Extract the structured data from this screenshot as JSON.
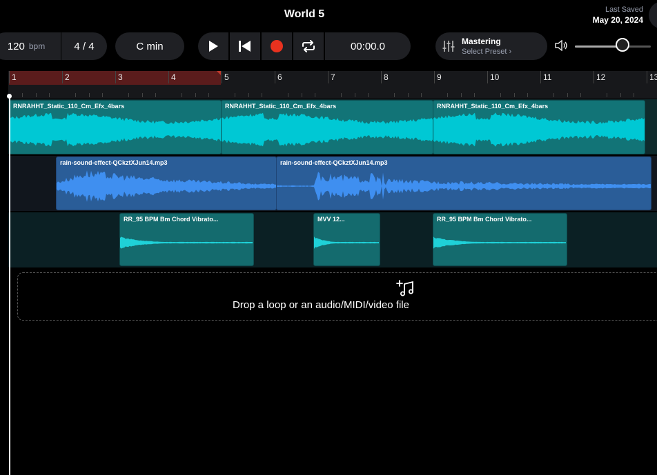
{
  "header": {
    "project_title": "World 5",
    "last_saved_label": "Last Saved",
    "last_saved_date": "May 20, 2024"
  },
  "toolbar": {
    "tempo_value": "120",
    "tempo_unit": "bpm",
    "time_signature": "4 / 4",
    "key": "C min",
    "timecode": "00:00.0",
    "mastering_title": "Mastering",
    "mastering_subtitle": "Select Preset",
    "volume_level": 0.63,
    "icons": [
      "play-icon",
      "skip-to-start-icon",
      "record-icon",
      "loop-icon",
      "mixer-sliders-icon",
      "speaker-icon"
    ],
    "record_color": "#e8321f"
  },
  "timeline": {
    "bar_numbers": [
      "1",
      "2",
      "3",
      "4",
      "5",
      "6",
      "7",
      "8",
      "9",
      "10",
      "11",
      "12",
      "13"
    ],
    "loop_color": "#5a1c1c"
  },
  "tracks": {
    "track1": {
      "clips": [
        {
          "name": "RNRAHHT_Static_110_Cm_Efx_4bars"
        },
        {
          "name": "RNRAHHT_Static_110_Cm_Efx_4bars"
        },
        {
          "name": "RNRAHHT_Static_110_Cm_Efx_4bars"
        }
      ],
      "color": "#00c8d4"
    },
    "track2": {
      "clips": [
        {
          "name": "rain-sound-effect-QCkztXJun14.mp3"
        },
        {
          "name": "rain-sound-effect-QCkztXJun14.mp3"
        }
      ],
      "color": "#3f8ff0"
    },
    "track3": {
      "clips": [
        {
          "name": "RR_95 BPM Bm Chord Vibrato..."
        },
        {
          "name": "MVV 12..."
        },
        {
          "name": "RR_95 BPM Bm Chord Vibrato..."
        }
      ],
      "color": "#1fd1d8"
    }
  },
  "drop_zone": {
    "text": "Drop a loop or an audio/MIDI/video file"
  }
}
